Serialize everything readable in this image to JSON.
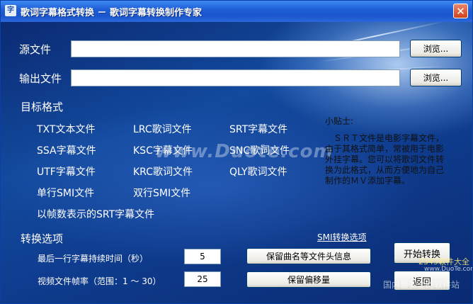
{
  "window": {
    "icon_glyph": "字",
    "title": "歌词字幕格式转换 － 歌词字幕转换制作专家",
    "close_glyph": "✕"
  },
  "source": {
    "label": "源文件",
    "value": "",
    "browse_label": "浏览..."
  },
  "output": {
    "label": "输出文件",
    "value": "",
    "browse_label": "浏览..."
  },
  "target_formats": {
    "label": "目标格式",
    "items": [
      "TXT文本文件",
      "LRC歌词文件",
      "SRT字幕文件",
      "SSA字幕文件",
      "KSC字幕文件",
      "SNC歌词文件",
      "UTF字幕文件",
      "KRC歌词文件",
      "QLY歌词文件",
      "单行SMI文件",
      "双行SMI文件",
      "以帧数表示的SRT字幕文件"
    ]
  },
  "tips": {
    "title": "小贴士:",
    "body": "　ＳＲＴ文件是电影字幕文件，由于其格式简单，常被用于电影外挂字幕。您可以将歌词文件转换为此格式，从而方便地为自己制作的ＭＶ添加字幕。"
  },
  "options": {
    "label": "转换选项",
    "smi_link": "SMI转换选项",
    "last_line_label": "最后一行字幕持续时间（秒）",
    "last_line_value": "5",
    "fps_label": "视频文件帧率（范围：1 ～ 30）",
    "fps_value": "25",
    "keep_header_button": "保留曲名等文件头信息",
    "keep_offset_button": "保留偏移量"
  },
  "actions": {
    "start": "开始转换",
    "back": "返回"
  },
  "watermarks": {
    "center": "www.Duote.com",
    "corner_top": "2345软件大全",
    "corner_url": "www.DuoTe.com",
    "corner_bottom": "国内最安全的软件站"
  }
}
